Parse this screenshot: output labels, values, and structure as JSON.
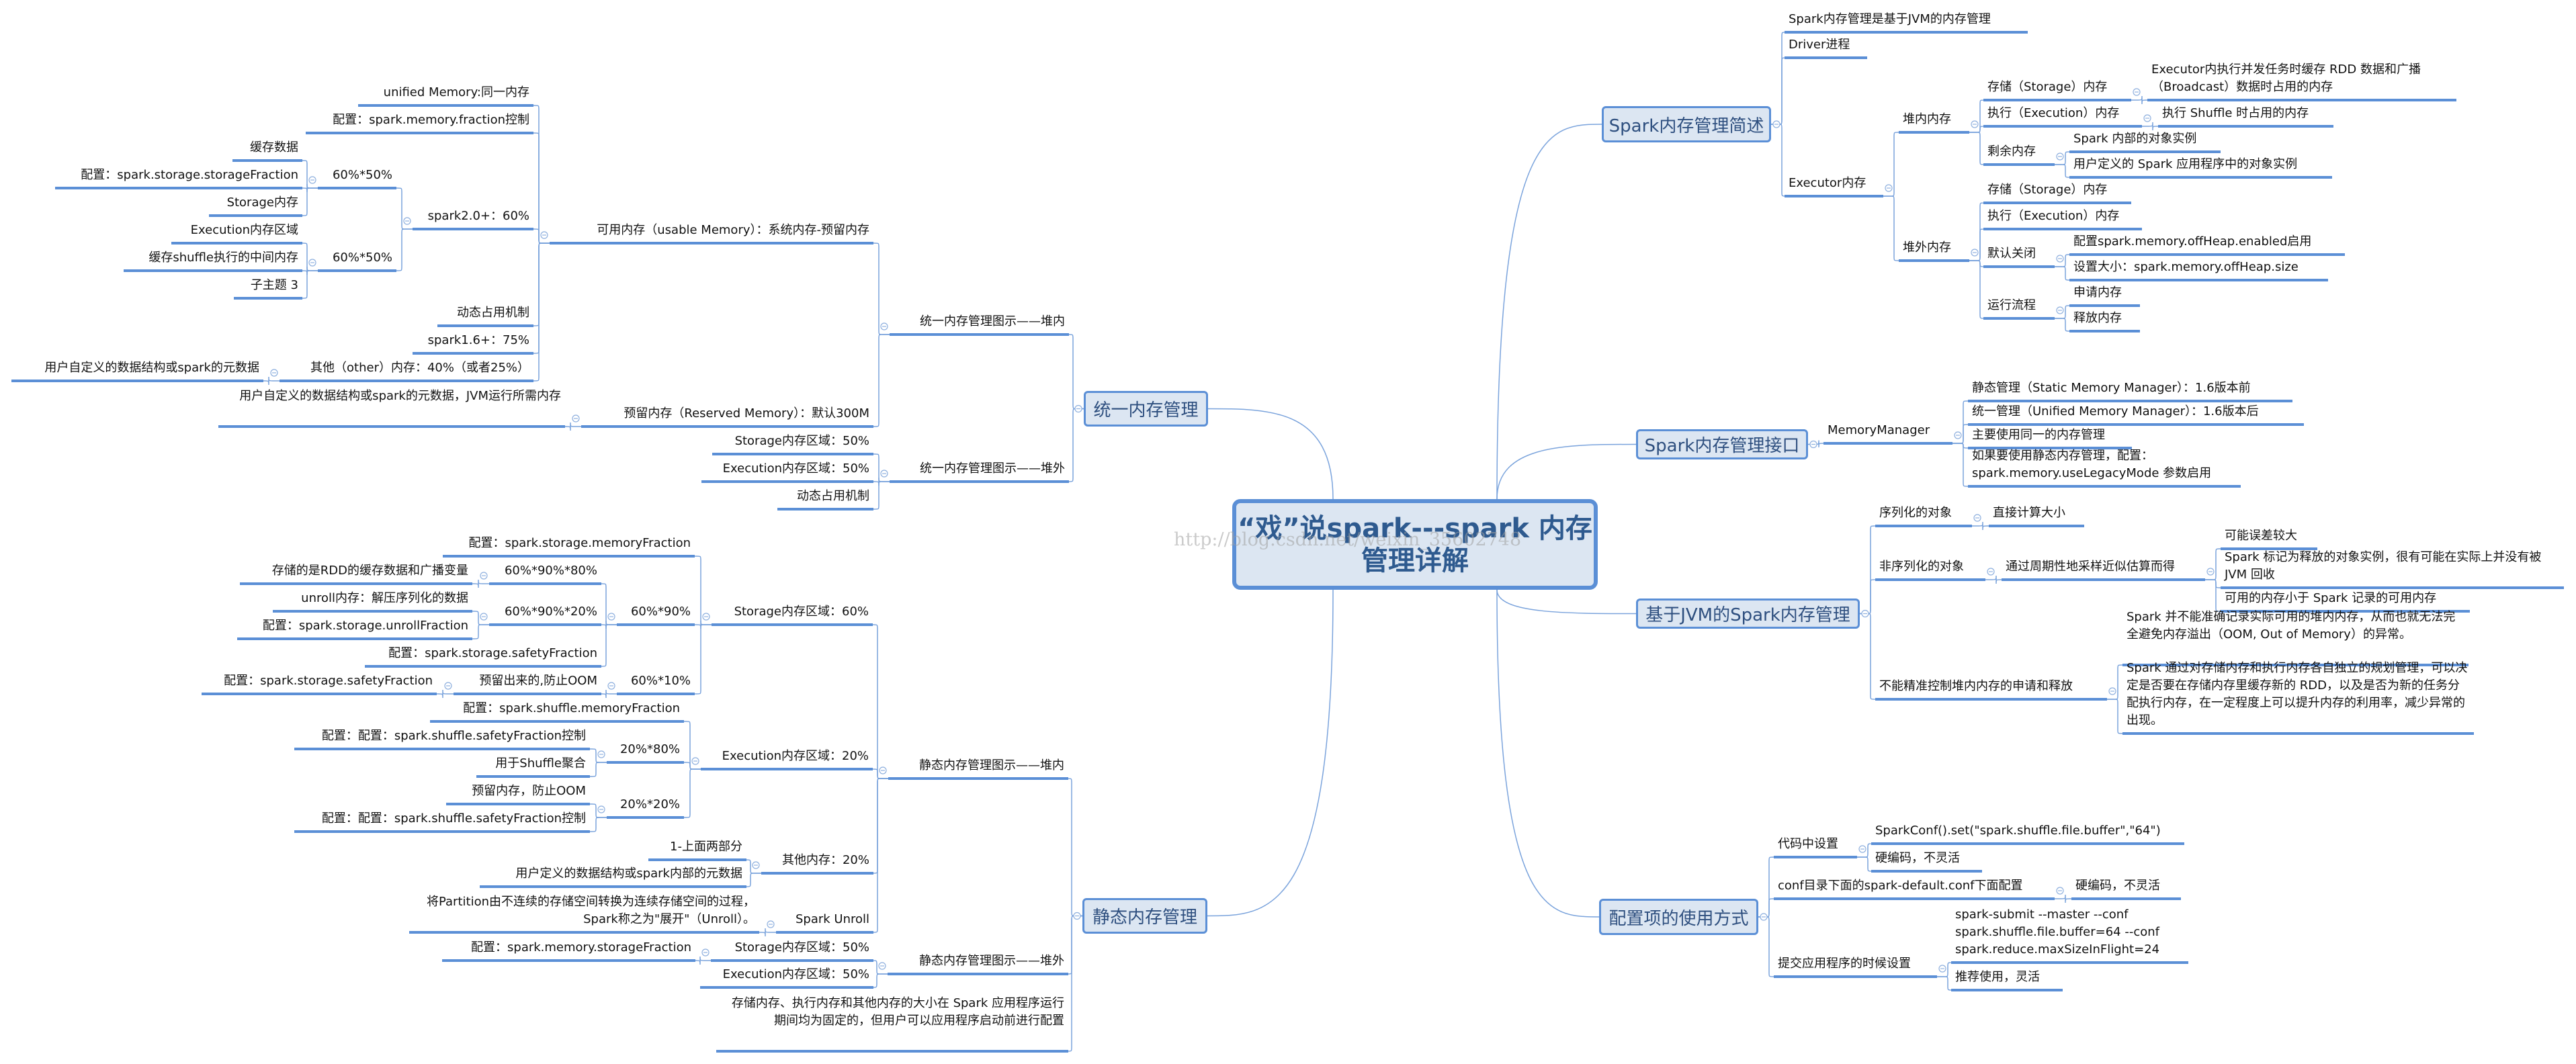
{
  "central": {
    "title_lines": [
      "“戏”说spark---spark 内存",
      "管理详解"
    ]
  },
  "watermark": "http://blog.csdn.net/weixin_35602748",
  "colors": {
    "underline": "#5b8fd6",
    "box_fill": "#dce6f2",
    "box_text": "#2e4f7f",
    "connector": "#7aa3dc"
  },
  "unified": {
    "title": "统一内存管理",
    "nodes": {
      "u1": "统一内存管理图示——堆内",
      "u2": "统一内存管理图示——堆外",
      "u1a": "可用内存（usable Memory）：系统内存-预留内存",
      "u1b": "预留内存（Reserved Memory）：默认300M",
      "u1a1": "unified Memory:同一内存",
      "u1a2": "配置：spark.memory.fraction控制",
      "u1a3": "spark2.0+：60%",
      "u1a4": "动态占用机制",
      "u1a5": "spark1.6+：75%",
      "u1a6": "其他（other）内存：40%（或者25%）",
      "u1a6a": "用户自定义的数据结构或spark的元数据",
      "u1a3a": "60%*50%",
      "u1a3b": "60%*50%",
      "u1a3a1": "缓存数据",
      "u1a3a2": "配置：spark.storage.storageFraction",
      "u1a3a3": "Storage内存",
      "u1a3b1": "Execution内存区域",
      "u1a3b2": "缓存shuffle执行的中间内存",
      "u1a3b3": "子主题 3",
      "u1b1": "用户自定义的数据结构或spark的元数据，JVM运行所需内存",
      "u2a": "Storage内存区域：50%",
      "u2b": "Execution内存区域：50%",
      "u2c": "动态占用机制"
    }
  },
  "static": {
    "title": "静态内存管理",
    "nodes": {
      "s1": "静态内存管理图示——堆内",
      "s2": "静态内存管理图示——堆外",
      "s3": "存储内存、执行内存和其他内存的大小在 Spark 应用程序运行期间均为固定的，但用户可以应用程序启动前进行配置",
      "s1a": "Storage内存区域：60%",
      "s1b": "Execution内存区域：20%",
      "s1c": "其他内存：20%",
      "s1d": "Spark Unroll",
      "s1a1": "配置：spark.storage.memoryFraction",
      "s1a2": "60%*90%",
      "s1a3": "60%*10%",
      "s1a2a": "60%*90%*80%",
      "s1a2b": "60%*90%*20%",
      "s1a2c": "配置：spark.storage.safetyFraction",
      "s1a2a1": "存储的是RDD的缓存数据和广播变量",
      "s1a2b1": "unroll内存：解压序列化的数据",
      "s1a2b2": "配置：spark.storage.unrollFraction",
      "s1a3a": "预留出来的,防止OOM",
      "s1a3a1": "配置：spark.storage.safetyFraction",
      "s1b1": "配置：spark.shuffle.memoryFraction",
      "s1b2": "20%*80%",
      "s1b3": "20%*20%",
      "s1b2a": "配置：配置：spark.shuffle.safetyFraction控制",
      "s1b2b": "用于Shuffle聚合",
      "s1b3a": "预留内存，防止OOM",
      "s1b3b": "配置：配置：spark.shuffle.safetyFraction控制",
      "s1c1": "1-上面两部分",
      "s1c2": "用户定义的数据结构或spark内部的元数据",
      "s1d1": "将Partition由不连续的存储空间转换为连续存储空间的过程，Spark称之为\"展开\"（Unroll）。",
      "s2a": "Storage内存区域：50%",
      "s2b": "Execution内存区域：50%",
      "s2a1": "配置：spark.memory.storageFraction"
    }
  },
  "overview": {
    "title": "Spark内存管理简述",
    "nodes": {
      "o1": "Spark内存管理是基于JVM的内存管理",
      "o2": "Driver进程",
      "o3": "Executor内存",
      "o3a": "堆内内存",
      "o3b": "堆外内存",
      "o3a1": "存储（Storage）内存",
      "o3a2": "执行（Execution）内存",
      "o3a3": "剩余内存",
      "o3a1a": "Executor内执行并发任务时缓存 RDD 数据和广播（Broadcast）数据时占用的内存",
      "o3a2a": "执行 Shuffle 时占用的内存",
      "o3a3a": "Spark 内部的对象实例",
      "o3a3b": "用户定义的 Spark 应用程序中的对象实例",
      "o3b1": "存储（Storage）内存",
      "o3b2": "执行（Execution）内存",
      "o3b3": "默认关闭",
      "o3b4": "运行流程",
      "o3b3a": "配置spark.memory.offHeap.enabled启用",
      "o3b3b": "设置大小：spark.memory.offHeap.size",
      "o3b4a": "申请内存",
      "o3b4b": "释放内存"
    }
  },
  "interface": {
    "title": "Spark内存管理接口",
    "nodes": {
      "i1": "MemoryManager",
      "i1a": "静态管理（Static Memory Manager）：1.6版本前",
      "i1b": "统一管理（Unified Memory Manager）：1.6版本后",
      "i1c": "主要使用同一的内存管理",
      "i1d": "如果要使用静态内存管理，配置：spark.memory.useLegacyMode 参数启用"
    }
  },
  "jvm": {
    "title": "基于JVM的Spark内存管理",
    "nodes": {
      "j1": "序列化的对象",
      "j1a": "直接计算大小",
      "j2": "非序列化的对象",
      "j2a": "通过周期性地采样近似估算而得",
      "j2a1": "可能误差较大",
      "j2a2": "Spark 标记为释放的对象实例，很有可能在实际上并没有被 JVM 回收",
      "j2a3": "可用的内存小于 Spark 记录的可用内存",
      "j3": "不能精准控制堆内内存的申请和释放",
      "j3a": "Spark 并不能准确记录实际可用的堆内内存，从而也就无法完全避免内存溢出（OOM, Out of Memory）的异常。",
      "j3b": "Spark 通过对存储内存和执行内存各自独立的规划管理，可以决定是否要在存储内存里缓存新的 RDD，以及是否为新的任务分配执行内存，在一定程度上可以提升内存的利用率，减少异常的出现。"
    }
  },
  "config": {
    "title": "配置项的使用方式",
    "nodes": {
      "c1": "代码中设置",
      "c1a": "SparkConf().set(\"spark.shuffle.file.buffer\",\"64\")",
      "c1b": "硬编码，不灵活",
      "c2": "conf目录下面的spark-default.conf下面配置",
      "c2a": "硬编码，不灵活",
      "c3": "提交应用程序的时候设置",
      "c3a": "spark-submit --master --conf spark.shuffle.file.buffer=64 --conf spark.reduce.maxSizeInFlight=24",
      "c3b": "推荐使用，灵活"
    }
  }
}
